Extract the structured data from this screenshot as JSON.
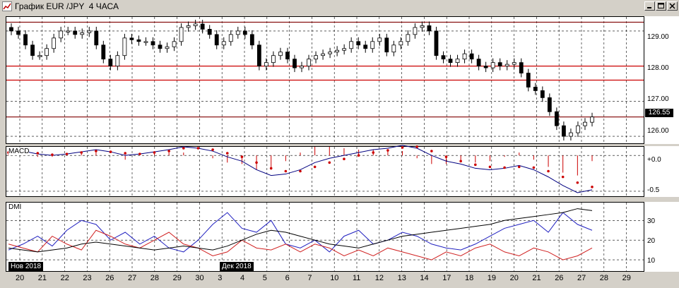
{
  "window": {
    "title": "График EUR /JPY  4 ЧАСА"
  },
  "price_axis": {
    "labels": [
      "129.00",
      "128.00",
      "127.00",
      "126.00"
    ],
    "current": "126.55"
  },
  "macd": {
    "label": "MACD",
    "axis": [
      "+0.0",
      "-0.5"
    ]
  },
  "dmi": {
    "label": "DMI",
    "axis": [
      "30",
      "20",
      "10"
    ]
  },
  "months": {
    "nov": "Нов 2018",
    "dec": "Дек 2018"
  },
  "x_labels": [
    "20",
    "21",
    "22",
    "23",
    "26",
    "27",
    "28",
    "29",
    "30",
    "3",
    "4",
    "5",
    "6",
    "7",
    "10",
    "11",
    "12",
    "13",
    "14",
    "17",
    "18",
    "19",
    "20",
    "21",
    "26",
    "27",
    "28",
    "29"
  ],
  "colors": {
    "candle": "#000000",
    "level": "#cc0000",
    "level_dark": "#800000",
    "signal": "#cc0000",
    "macd": "#000080",
    "di_plus": "#2020c0",
    "di_minus": "#d02020",
    "adx": "#000000"
  },
  "chart_data": [
    {
      "type": "candlestick",
      "yaxis_ticks": [
        129.0,
        128.0,
        127.0,
        126.0
      ],
      "ylim": [
        125.8,
        129.4
      ],
      "current_price": 126.55,
      "horizontal_levels": [
        129.25,
        128.0,
        127.6,
        126.55
      ],
      "close": [
        129.0,
        128.9,
        128.6,
        128.3,
        128.3,
        128.5,
        128.8,
        129.0,
        129.0,
        128.9,
        128.95,
        129.0,
        128.6,
        128.2,
        128.0,
        128.3,
        128.8,
        128.75,
        128.7,
        128.7,
        128.6,
        128.5,
        128.55,
        128.7,
        129.1,
        129.15,
        129.2,
        129.05,
        128.9,
        128.6,
        128.7,
        128.9,
        129.0,
        128.9,
        128.6,
        128.0,
        128.1,
        128.3,
        128.4,
        128.2,
        127.95,
        128.0,
        128.2,
        128.3,
        128.35,
        128.4,
        128.45,
        128.5,
        128.7,
        128.6,
        128.5,
        128.7,
        128.8,
        128.4,
        128.6,
        128.7,
        128.9,
        129.1,
        129.15,
        129.0,
        128.3,
        128.2,
        128.1,
        128.2,
        128.35,
        128.2,
        128.0,
        127.95,
        128.1,
        128.0,
        128.05,
        128.1,
        127.8,
        127.4,
        127.3,
        127.1,
        126.7,
        126.3,
        126.0,
        126.1,
        126.3,
        126.4,
        126.55
      ],
      "xlabels": [
        "20",
        "21",
        "22",
        "23",
        "26",
        "27",
        "28",
        "29",
        "30",
        "3",
        "4",
        "5",
        "6",
        "7",
        "10",
        "11",
        "12",
        "13",
        "14",
        "17",
        "18",
        "19",
        "20",
        "21",
        "26",
        "27",
        "28",
        "29"
      ]
    },
    {
      "type": "line",
      "name": "MACD",
      "yaxis_ticks": [
        0.0,
        -0.5
      ],
      "series": [
        {
          "name": "MACD",
          "values": [
            0.05,
            0.06,
            0.02,
            0.0,
            0.02,
            0.05,
            0.08,
            0.05,
            0.0,
            0.02,
            0.05,
            0.08,
            0.12,
            0.1,
            0.06,
            -0.02,
            -0.08,
            -0.2,
            -0.28,
            -0.26,
            -0.2,
            -0.1,
            -0.04,
            0.0,
            0.04,
            0.08,
            0.1,
            0.14,
            0.1,
            0.0,
            -0.08,
            -0.12,
            -0.18,
            -0.2,
            -0.18,
            -0.14,
            -0.2,
            -0.3,
            -0.42,
            -0.52,
            -0.48
          ]
        },
        {
          "name": "Signal",
          "values": [
            0.04,
            0.05,
            0.03,
            0.01,
            0.02,
            0.04,
            0.06,
            0.05,
            0.03,
            0.02,
            0.04,
            0.06,
            0.1,
            0.1,
            0.08,
            0.03,
            -0.02,
            -0.1,
            -0.18,
            -0.22,
            -0.22,
            -0.16,
            -0.1,
            -0.05,
            0.0,
            0.04,
            0.07,
            0.11,
            0.12,
            0.06,
            -0.02,
            -0.08,
            -0.13,
            -0.16,
            -0.17,
            -0.16,
            -0.17,
            -0.22,
            -0.3,
            -0.38,
            -0.44
          ]
        }
      ]
    },
    {
      "type": "line",
      "name": "DMI",
      "yaxis_ticks": [
        30,
        20,
        10
      ],
      "series": [
        {
          "name": "DI+",
          "values": [
            15,
            18,
            22,
            17,
            25,
            30,
            28,
            20,
            24,
            18,
            22,
            16,
            14,
            20,
            28,
            34,
            26,
            24,
            30,
            18,
            16,
            20,
            14,
            22,
            25,
            18,
            20,
            24,
            22,
            18,
            16,
            15,
            18,
            22,
            26,
            28,
            30,
            24,
            34,
            28,
            25
          ]
        },
        {
          "name": "DI-",
          "values": [
            18,
            16,
            14,
            22,
            18,
            15,
            25,
            22,
            18,
            16,
            20,
            24,
            18,
            16,
            12,
            14,
            20,
            16,
            15,
            18,
            14,
            18,
            16,
            12,
            15,
            12,
            16,
            14,
            12,
            10,
            14,
            12,
            16,
            18,
            14,
            12,
            16,
            14,
            10,
            12,
            16
          ]
        },
        {
          "name": "ADX",
          "values": [
            16,
            15,
            14,
            15,
            16,
            18,
            19,
            18,
            17,
            16,
            15,
            16,
            17,
            16,
            15,
            17,
            20,
            23,
            25,
            24,
            22,
            20,
            18,
            17,
            16,
            18,
            20,
            22,
            23,
            24,
            25,
            26,
            27,
            28,
            30,
            31,
            32,
            33,
            34,
            36,
            35
          ]
        }
      ]
    }
  ]
}
